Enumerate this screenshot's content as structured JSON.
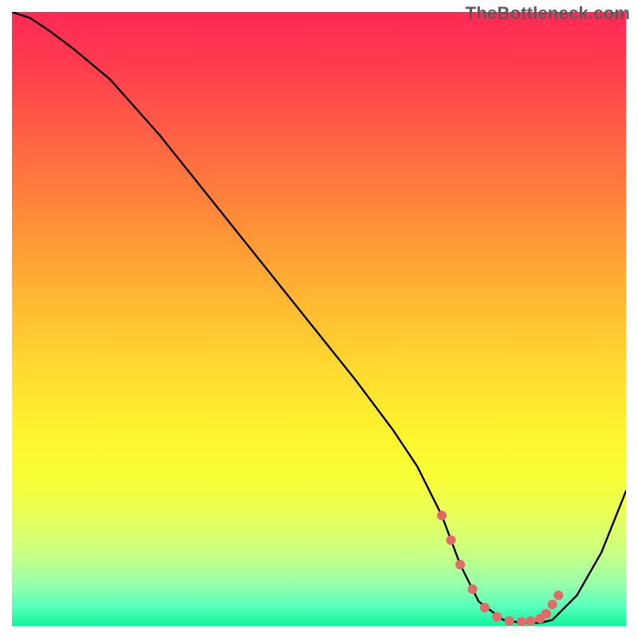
{
  "watermark": "TheBottleneck.com",
  "chart_data": {
    "type": "line",
    "title": "",
    "xlabel": "",
    "ylabel": "",
    "xlim": [
      0,
      100
    ],
    "ylim": [
      0,
      100
    ],
    "grid": false,
    "legend": false,
    "series": [
      {
        "name": "bottleneck-curve",
        "color": "#000000",
        "x": [
          0,
          3,
          6,
          10,
          16,
          24,
          32,
          40,
          48,
          56,
          62,
          66,
          70,
          73,
          76,
          80,
          83,
          86,
          88,
          92,
          96,
          100
        ],
        "y": [
          100,
          99,
          97,
          94,
          89,
          80,
          70,
          60,
          50,
          40,
          32,
          26,
          18,
          10,
          4,
          1,
          0.5,
          0.5,
          1,
          5,
          12,
          22
        ]
      }
    ],
    "highlight_points": {
      "name": "optimal-range-dots",
      "color": "#e46a6a",
      "x": [
        70,
        71.5,
        73,
        75,
        77,
        79,
        81,
        83,
        84.5,
        86,
        87,
        88,
        89
      ],
      "y": [
        18,
        14,
        10,
        6,
        3,
        1.5,
        0.8,
        0.7,
        0.8,
        1.2,
        2,
        3.5,
        5
      ]
    }
  }
}
